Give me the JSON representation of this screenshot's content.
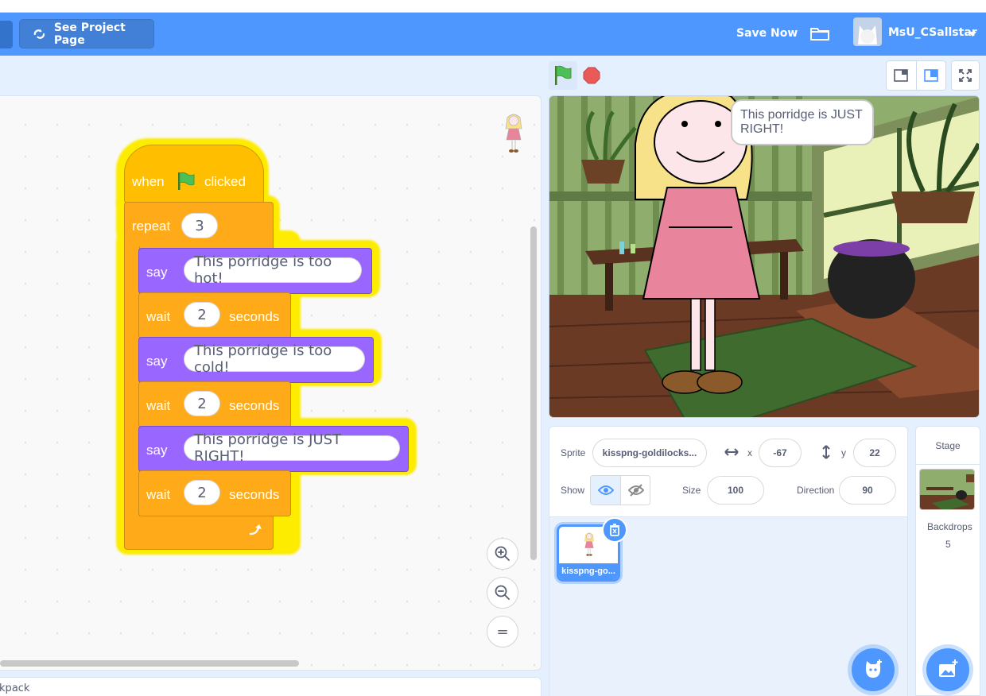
{
  "menu": {
    "see_project_page": "See Project Page",
    "save_now": "Save Now",
    "username": "MsU_CSallstar"
  },
  "code": {
    "hat": {
      "when": "when",
      "clicked": "clicked"
    },
    "repeat": {
      "label": "repeat",
      "count": "3"
    },
    "blocks": [
      {
        "type": "say",
        "label": "say",
        "text": "This porridge is too hot!"
      },
      {
        "type": "wait",
        "label": "wait",
        "value": "2",
        "unit": "seconds"
      },
      {
        "type": "say",
        "label": "say",
        "text": "This porridge is too cold!"
      },
      {
        "type": "wait",
        "label": "wait",
        "value": "2",
        "unit": "seconds"
      },
      {
        "type": "say",
        "label": "say",
        "text": "This porridge is JUST RIGHT!"
      },
      {
        "type": "wait",
        "label": "wait",
        "value": "2",
        "unit": "seconds"
      }
    ],
    "zoom_reset_glyph": "="
  },
  "backpack": {
    "label": "Backpack"
  },
  "stage": {
    "speech_bubble": "This porridge is JUST RIGHT!"
  },
  "sprite_info": {
    "sprite_label": "Sprite",
    "sprite_name": "kisspng-goldilocks...",
    "x_label": "x",
    "x_value": "-67",
    "y_label": "y",
    "y_value": "22",
    "show_label": "Show",
    "size_label": "Size",
    "size_value": "100",
    "direction_label": "Direction",
    "direction_value": "90"
  },
  "sprites": [
    {
      "name": "kisspng-go..."
    }
  ],
  "stage_panel": {
    "title": "Stage",
    "backdrops_label": "Backdrops",
    "backdrops_count": "5"
  },
  "colors": {
    "menu_blue": "#4d97ff",
    "events": "#ffbf00",
    "control": "#ffab19",
    "looks": "#9966ff",
    "glow": "#fdeb00"
  },
  "icons": [
    "project-page-icon",
    "folder-icon",
    "avatar",
    "green-flag-icon",
    "stop-icon",
    "small-stage-icon",
    "normal-stage-icon",
    "fullscreen-icon",
    "zoom-in-icon",
    "zoom-out-icon",
    "eye-icon",
    "eye-off-icon",
    "trash-icon",
    "choose-sprite-icon",
    "choose-backdrop-icon",
    "turn-arrow-icon"
  ]
}
